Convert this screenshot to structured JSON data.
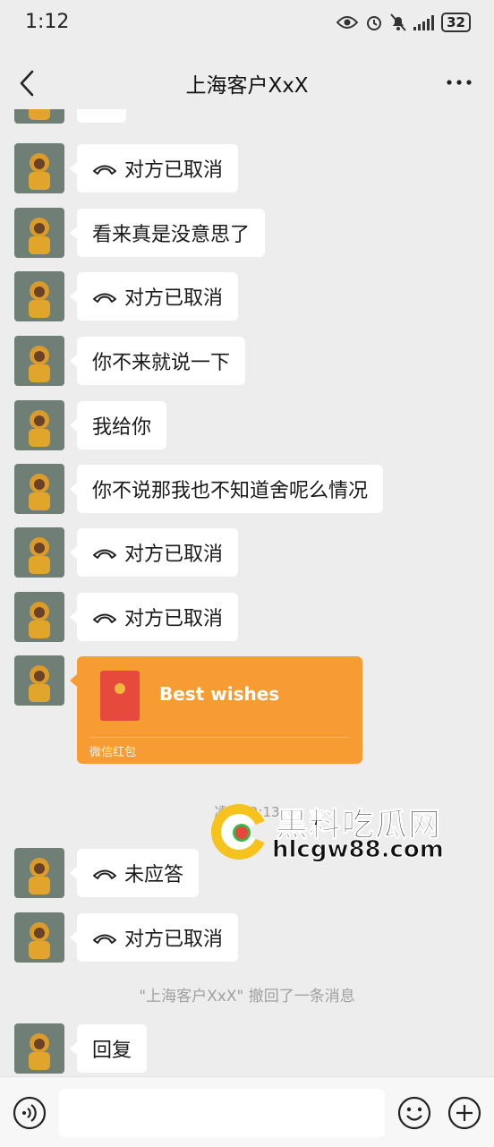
{
  "status_bar": {
    "time": "1:12",
    "battery": "32"
  },
  "header": {
    "title": "上海客户XxX"
  },
  "messages": [
    {
      "type": "text",
      "text": "..."
    },
    {
      "type": "call",
      "text": "对方已取消"
    },
    {
      "type": "text",
      "text": "看来真是没意思了"
    },
    {
      "type": "call",
      "text": "对方已取消"
    },
    {
      "type": "text",
      "text": "你不来就说一下"
    },
    {
      "type": "text",
      "text": "我给你"
    },
    {
      "type": "text",
      "text": "你不说那我也不知道舍呢么情况"
    },
    {
      "type": "call",
      "text": "对方已取消"
    },
    {
      "type": "call",
      "text": "对方已取消"
    },
    {
      "type": "red_packet",
      "title": "Best wishes",
      "footer": "微信红包"
    },
    {
      "type": "time",
      "text": "凌晨12:13"
    },
    {
      "type": "call",
      "text": "未应答"
    },
    {
      "type": "call",
      "text": "对方已取消"
    },
    {
      "type": "system",
      "text": "\"上海客户XxX\" 撤回了一条消息"
    },
    {
      "type": "text",
      "text": "回复"
    }
  ],
  "watermark": {
    "line1": "黑料吃瓜网",
    "line2": "hlcgw88.com"
  },
  "icons": {
    "back": "chevron-left-icon",
    "more": "more-icon",
    "call": "hangup-phone-icon",
    "voice": "voice-icon",
    "emoji": "emoji-icon",
    "plus": "plus-icon"
  },
  "colors": {
    "background": "#ededed",
    "bubble": "#ffffff",
    "red_packet": "#f79c33",
    "envelope": "#e64a3c"
  }
}
